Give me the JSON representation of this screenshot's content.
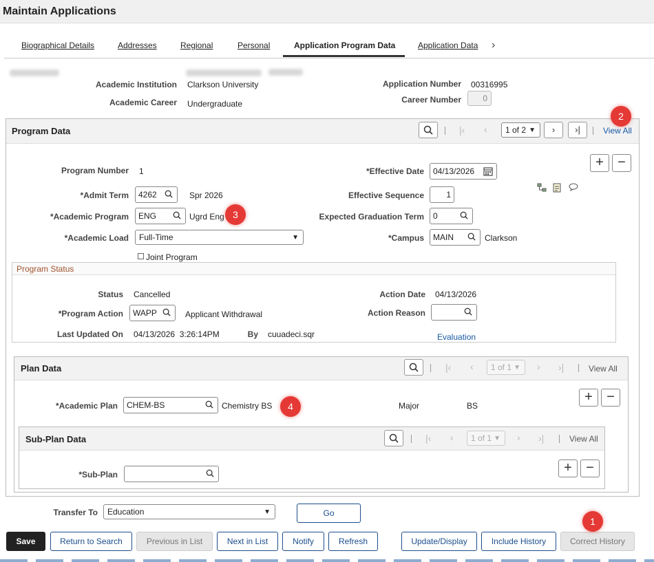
{
  "page": {
    "title": "Maintain Applications"
  },
  "tabs": [
    "Biographical Details",
    "Addresses",
    "Regional",
    "Personal",
    "Application Program Data",
    "Application Data"
  ],
  "header": {
    "institution_label": "Academic Institution",
    "institution_value": "Clarkson University",
    "career_label": "Academic Career",
    "career_value": "Undergraduate",
    "appnum_label": "Application Number",
    "appnum_value": "00316995",
    "careernum_label": "Career Number",
    "careernum_value": "0"
  },
  "program": {
    "title": "Program Data",
    "pager": "1 of 2",
    "view_all": "View All",
    "program_number_label": "Program Number",
    "program_number": "1",
    "admit_term_label": "*Admit Term",
    "admit_term": "4262",
    "admit_term_desc": "Spr 2026",
    "acad_program_label": "*Academic Program",
    "acad_program": "ENG",
    "acad_program_desc": "Ugrd Eng",
    "acad_load_label": "*Academic Load",
    "acad_load": "Full-Time",
    "joint_program_label": "Joint Program",
    "eff_date_label": "*Effective Date",
    "eff_date": "04/13/2026",
    "eff_seq_label": "Effective Sequence",
    "eff_seq": "1",
    "exp_grad_label": "Expected Graduation Term",
    "exp_grad": "0",
    "campus_label": "*Campus",
    "campus": "MAIN",
    "campus_desc": "Clarkson"
  },
  "program_status": {
    "title": "Program Status",
    "status_label": "Status",
    "status": "Cancelled",
    "prog_action_label": "*Program Action",
    "prog_action": "WAPP",
    "prog_action_desc": "Applicant Withdrawal",
    "last_updated_label": "Last Updated On",
    "last_updated": "04/13/2026  3:26:14PM",
    "by_label": "By",
    "by": "cuuadeci.sqr",
    "action_date_label": "Action Date",
    "action_date": "04/13/2026",
    "action_reason_label": "Action Reason",
    "action_reason": "",
    "evaluation_link": "Evaluation"
  },
  "plan": {
    "title": "Plan Data",
    "pager": "1 of 1",
    "view_all": "View All",
    "acad_plan_label": "*Academic Plan",
    "acad_plan": "CHEM-BS",
    "acad_plan_desc": "Chemistry BS",
    "type": "Major",
    "degree": "BS"
  },
  "subplan": {
    "title": "Sub-Plan Data",
    "pager": "1 of 1",
    "view_all": "View All",
    "subplan_label": "*Sub-Plan",
    "subplan": ""
  },
  "transfer": {
    "label": "Transfer To",
    "value": "Education",
    "go": "Go"
  },
  "buttons": {
    "save": "Save",
    "return": "Return to Search",
    "prev": "Previous in List",
    "next": "Next in List",
    "notify": "Notify",
    "refresh": "Refresh",
    "update": "Update/Display",
    "include_history": "Include History",
    "correct_history": "Correct History"
  },
  "badges": [
    "1",
    "2",
    "3",
    "4"
  ],
  "colors": {
    "link": "#1a5aa5",
    "badge": "#e53935",
    "status_title": "#a0522d"
  }
}
